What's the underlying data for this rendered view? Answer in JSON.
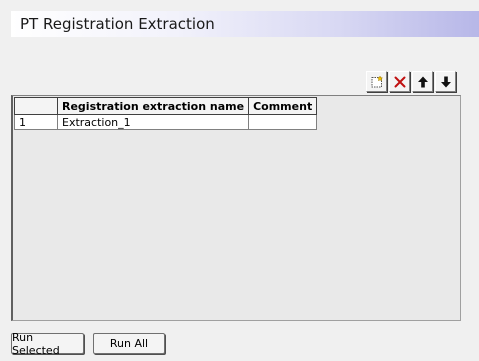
{
  "header": {
    "title": "PT Registration Extraction"
  },
  "toolbar": {
    "buttons": [
      {
        "icon": "new-icon"
      },
      {
        "icon": "delete-icon"
      },
      {
        "icon": "move-up-icon"
      },
      {
        "icon": "move-down-icon"
      }
    ]
  },
  "grid": {
    "columns": [
      "",
      "Registration extraction name",
      "Comment"
    ],
    "rows": [
      {
        "index": "1",
        "name": "Extraction_1",
        "comment": ""
      }
    ]
  },
  "footer": {
    "run_selected_label": "Run Selected",
    "run_all_label": "Run All"
  }
}
